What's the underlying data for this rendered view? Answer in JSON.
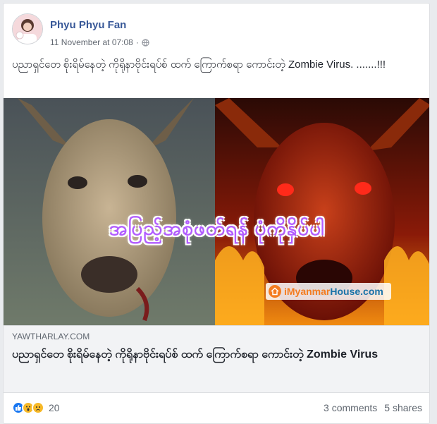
{
  "post": {
    "author": "Phyu Phyu Fan",
    "timestamp": "11 November at 07:08",
    "privacy_icon": "globe-icon",
    "text": "ပညာရှင်တေ စိုးရိမ်နေတဲ့ ကိုရိုနာဗိုင်းရပ်စ် ထက် ကြောက်စရာ ကောင်းတဲ့ Zombie Virus. .......!!!"
  },
  "image": {
    "overlay_text": "အပြည့်အစုံဖတ်ရန် ပုံကိုနှိပ်ပါ",
    "watermark_a": "iMyanmar",
    "watermark_b": "House.com"
  },
  "link": {
    "domain": "YAWTHARLAY.COM",
    "title": "ပညာရှင်တေ စိုးရိမ်နေတဲ့ ကိုရိုနာဗိုင်းရပ်စ် ထက် ကြောက်စရာ ကောင်းတဲ့ Zombie Virus"
  },
  "footer": {
    "reaction_icons": [
      "like-icon",
      "wow-icon",
      "sad-icon"
    ],
    "reaction_count": "20",
    "comments": "3 comments",
    "shares": "5 shares"
  },
  "colors": {
    "author": "#385898",
    "link_bg": "#f2f3f5",
    "overlay": "#b25cff"
  }
}
